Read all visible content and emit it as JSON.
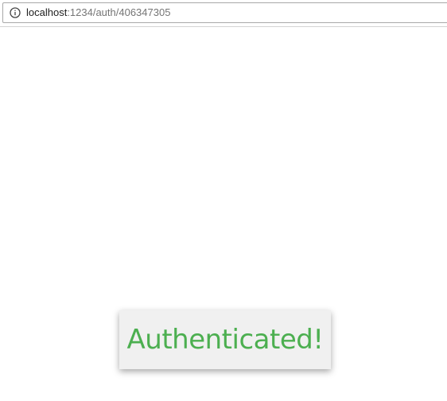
{
  "browser": {
    "address_bar": {
      "host": "localhost",
      "path": ":1234/auth/406347305",
      "info_icon": "info-circle-icon"
    }
  },
  "toast": {
    "message": "Authenticated!",
    "text_color": "#4caf50",
    "background": "#f0f0f0"
  }
}
